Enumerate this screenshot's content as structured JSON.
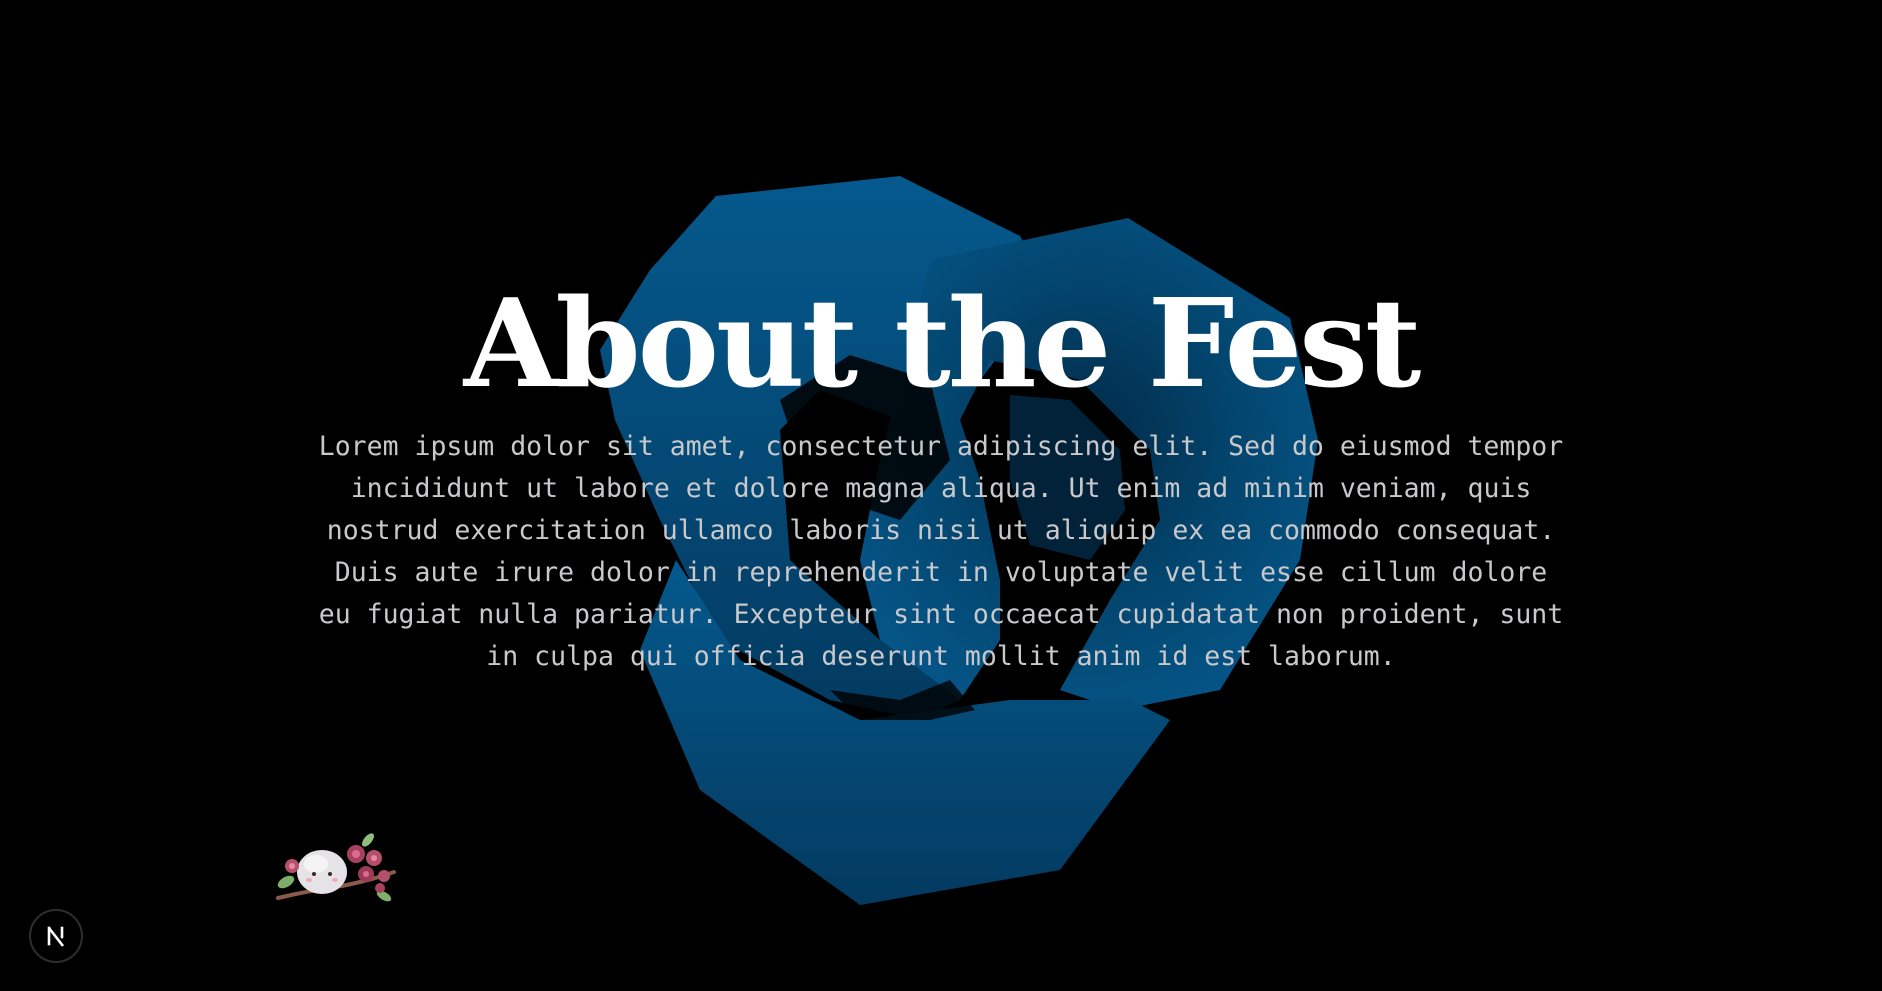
{
  "section": {
    "title": "About the Fest",
    "description": "Lorem ipsum dolor sit amet, consectetur adipiscing elit. Sed do eiusmod tempor incididunt ut labore et dolore magna aliqua. Ut enim ad minim veniam, quis nostrud exercitation ullamco laboris nisi ut aliquip ex ea commodo consequat. Duis aute irure dolor in reprehenderit in voluptate velit esse cillum dolore eu fugiat nulla pariatur. Excepteur sint occaecat cupidatat non proident, sunt in culpa qui officia deserunt mollit anim id est laborum."
  },
  "decorations": {
    "background_shape": "blue-3d-knot",
    "mascot": "mochi-with-flowers-icon"
  },
  "dev_badge": {
    "icon": "nextjs-logo-icon"
  },
  "colors": {
    "background": "#000000",
    "knot": "#044a78",
    "title": "#ffffff",
    "body_text": "#c9c9cc"
  }
}
